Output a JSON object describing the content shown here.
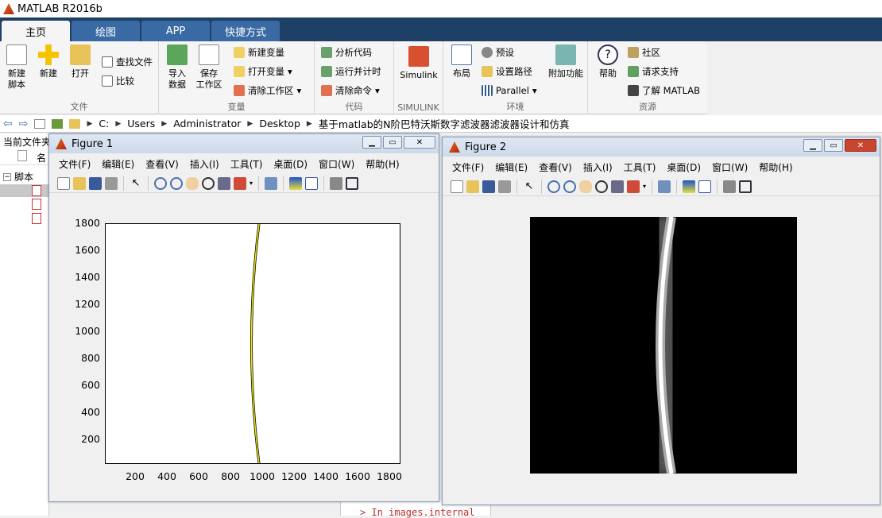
{
  "app": {
    "title": "MATLAB R2016b"
  },
  "tabs": [
    "主页",
    "绘图",
    "APP",
    "快捷方式"
  ],
  "ribbon": {
    "file": {
      "label": "文件",
      "new_script": "新建\n脚本",
      "new": "新建",
      "open": "打开",
      "find_files": "查找文件",
      "compare": "比较"
    },
    "variable": {
      "label": "变量",
      "import": "导入\n数据",
      "save_ws": "保存\n工作区",
      "new_var": "新建变量",
      "open_var": "打开变量",
      "clear_ws": "清除工作区"
    },
    "code": {
      "label": "代码",
      "analyze": "分析代码",
      "run_time": "运行并计时",
      "clear_cmd": "清除命令"
    },
    "simulink": {
      "label": "SIMULINK",
      "simulink": "Simulink"
    },
    "env": {
      "label": "环境",
      "layout": "布局",
      "prefs": "预设",
      "set_path": "设置路径",
      "parallel": "Parallel",
      "addons": "附加功能"
    },
    "resources": {
      "label": "资源",
      "help": "帮助",
      "community": "社区",
      "support": "请求支持",
      "learn": "了解 MATLAB"
    }
  },
  "path": [
    "C:",
    "Users",
    "Administrator",
    "Desktop",
    "基于matlab的N阶巴特沃斯数字滤波器滤波器设计和仿真"
  ],
  "left": {
    "current_folder": "当前文件夹",
    "name_col": "名",
    "scripts": "脚本"
  },
  "fig_menu": [
    "文件(F)",
    "编辑(E)",
    "查看(V)",
    "插入(I)",
    "工具(T)",
    "桌面(D)",
    "窗口(W)",
    "帮助(H)"
  ],
  "fig1": {
    "title": "Figure 1",
    "yticks": [
      "1800",
      "1600",
      "1400",
      "1200",
      "1000",
      "800",
      "600",
      "400",
      "200"
    ],
    "xticks": [
      "200",
      "400",
      "600",
      "800",
      "1000",
      "1200",
      "1400",
      "1600",
      "1800"
    ]
  },
  "fig2": {
    "title": "Figure 2"
  },
  "command_fragment": "> In images.internal"
}
